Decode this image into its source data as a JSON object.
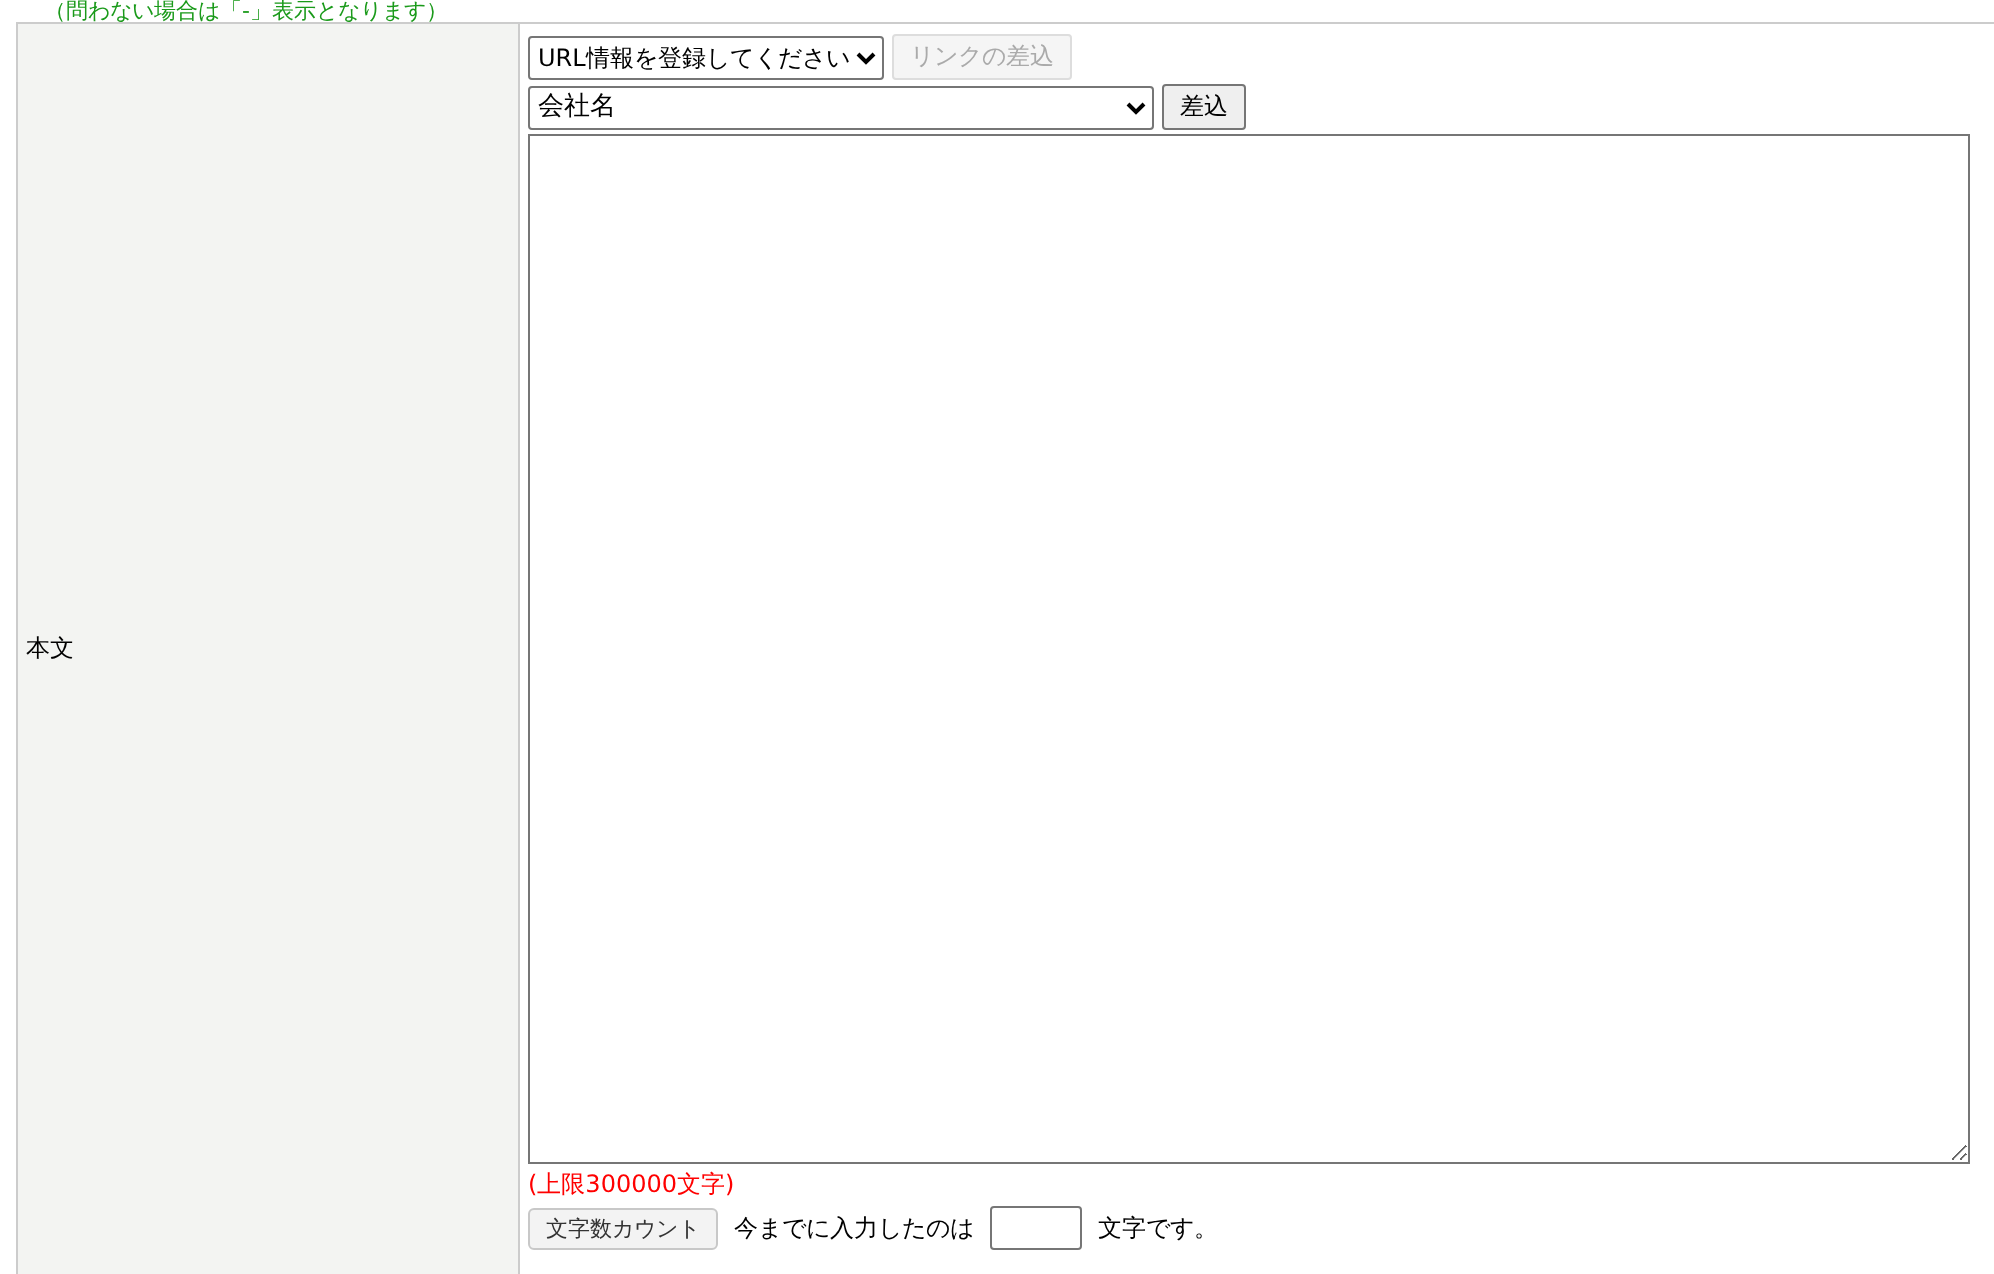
{
  "note": "（問わない場合は「-」表示となります）",
  "row": {
    "label": "本文",
    "url_select": {
      "value": "URL情報を登録してください"
    },
    "link_button": {
      "label": "リンクの差込",
      "disabled": true
    },
    "field_select": {
      "value": "会社名"
    },
    "insert_button": {
      "label": "差込",
      "disabled": false
    },
    "limit": "(上限300000文字)",
    "count_button": {
      "label": "文字数カウント"
    },
    "count_prefix": "今までに入力したのは",
    "count_suffix": "文字です。"
  }
}
